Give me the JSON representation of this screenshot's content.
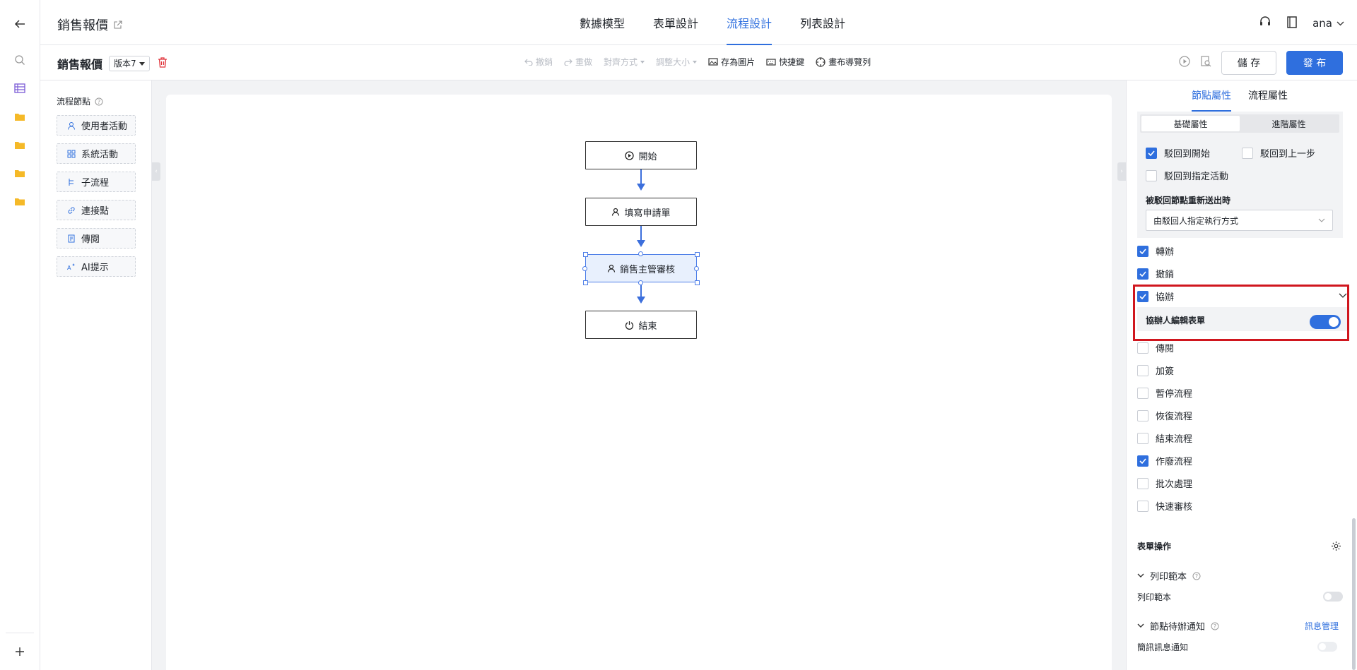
{
  "app": {
    "title": "銷售報價",
    "tabs": [
      "數據模型",
      "表單設計",
      "流程設計",
      "列表設計"
    ],
    "active_tab": "流程設計",
    "user": "ana"
  },
  "toolbar": {
    "flow_name": "銷售報價",
    "version": "版本7",
    "undo": "撤銷",
    "redo": "重做",
    "align": "對齊方式",
    "resize": "調整大小",
    "save_image": "存為圖片",
    "shortcuts": "快捷鍵",
    "canvas_nav": "畫布導覽列",
    "save": "儲 存",
    "publish": "發 布"
  },
  "palette": {
    "title": "流程節點",
    "items": [
      "使用者活動",
      "系統活動",
      "子流程",
      "連接點",
      "傳閱",
      "AI提示"
    ]
  },
  "flow": {
    "nodes": [
      "開始",
      "填寫申請單",
      "銷售主管審核",
      "結束"
    ],
    "selected": "銷售主管審核"
  },
  "props": {
    "tabs": [
      "節點屬性",
      "流程屬性"
    ],
    "active_tab": "節點屬性",
    "segments": [
      "基礎屬性",
      "進階屬性"
    ],
    "active_segment": "基礎屬性",
    "reject_options": [
      {
        "label": "駁回到開始",
        "checked": true
      },
      {
        "label": "駁回到上一步",
        "checked": false
      },
      {
        "label": "駁回到指定活動",
        "checked": false
      }
    ],
    "resubmit_label": "被駁回節點重新送出時",
    "resubmit_value": "由駁回人指定執行方式",
    "ops": [
      {
        "label": "轉辦",
        "checked": true
      },
      {
        "label": "撤銷",
        "checked": true
      },
      {
        "label": "協辦",
        "checked": true
      },
      {
        "label": "傳閱",
        "checked": false
      },
      {
        "label": "加簽",
        "checked": false
      },
      {
        "label": "暫停流程",
        "checked": false
      },
      {
        "label": "恢復流程",
        "checked": false
      },
      {
        "label": "結束流程",
        "checked": false
      },
      {
        "label": "作廢流程",
        "checked": true
      },
      {
        "label": "批次處理",
        "checked": false
      },
      {
        "label": "快速審核",
        "checked": false
      }
    ],
    "assist_edit_form": "協辦人編輯表單",
    "assist_edit_form_on": true,
    "form_ops": "表單操作",
    "print_section": "列印範本",
    "print_label": "列印範本",
    "print_on": false,
    "notify_section": "節點待辦通知",
    "notify_link": "訊息管理",
    "sms_label": "簡訊訊息通知",
    "sms_on": false
  }
}
